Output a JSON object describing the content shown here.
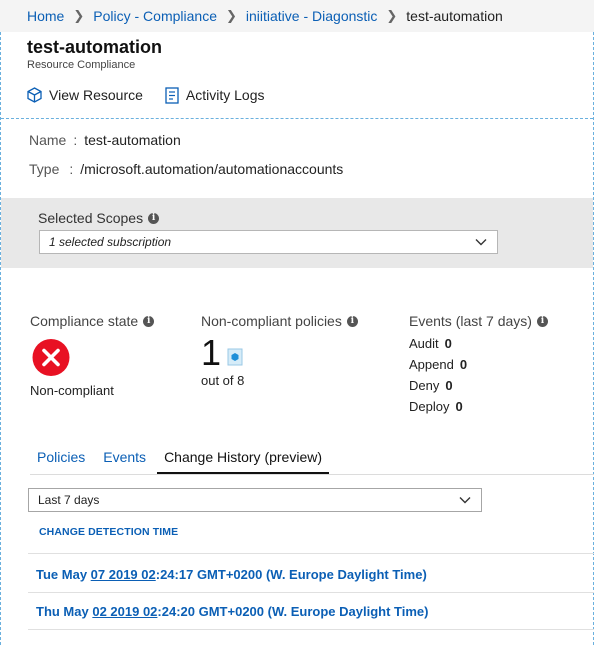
{
  "breadcrumb": [
    {
      "label": "Home"
    },
    {
      "label": "Policy - Compliance"
    },
    {
      "label": "iniitiative - Diagonstic"
    },
    {
      "label": "test-automation"
    }
  ],
  "header": {
    "title": "test-automation",
    "subtitle": "Resource Compliance"
  },
  "toolbar": {
    "view_resource_label": "View Resource",
    "activity_logs_label": "Activity Logs"
  },
  "properties": {
    "name_key": "Name",
    "name_value": "test-automation",
    "type_key": "Type",
    "type_value": "/microsoft.automation/automationaccounts",
    "colon": ":"
  },
  "scopes": {
    "label": "Selected Scopes",
    "value": "1 selected subscription"
  },
  "compliance": {
    "label": "Compliance state",
    "value": "Non-compliant",
    "status_color": "#e81123"
  },
  "noncompliant": {
    "label": "Non-compliant policies",
    "count": "1",
    "out_of": "out of 8"
  },
  "events": {
    "label": "Events (last 7 days)",
    "items": [
      {
        "name": "Audit",
        "count": "0"
      },
      {
        "name": "Append",
        "count": "0"
      },
      {
        "name": "Deny",
        "count": "0"
      },
      {
        "name": "Deploy",
        "count": "0"
      }
    ]
  },
  "tabs": [
    {
      "label": "Policies",
      "active": false
    },
    {
      "label": "Events",
      "active": false
    },
    {
      "label": "Change History (preview)",
      "active": true
    }
  ],
  "history": {
    "range_value": "Last 7 days",
    "column_header": "CHANGE DETECTION TIME",
    "entries": [
      {
        "pre": "Tue May ",
        "link": "07 2019 02",
        "post": ":24:17 GMT+0200 (W. Europe Daylight Time)"
      },
      {
        "pre": "Thu May ",
        "link": "02 2019 02",
        "post": ":24:20 GMT+0200 (W. Europe Daylight Time)"
      }
    ]
  },
  "icons": {
    "cube": "cube-icon",
    "log": "activity-log-icon",
    "info": "info-icon",
    "error": "error-icon",
    "policy": "policy-icon",
    "chevron": "chevron-down-icon"
  },
  "colors": {
    "accent": "#0b5fb5",
    "error": "#e81123",
    "scope_bg": "#e8e8e8"
  }
}
